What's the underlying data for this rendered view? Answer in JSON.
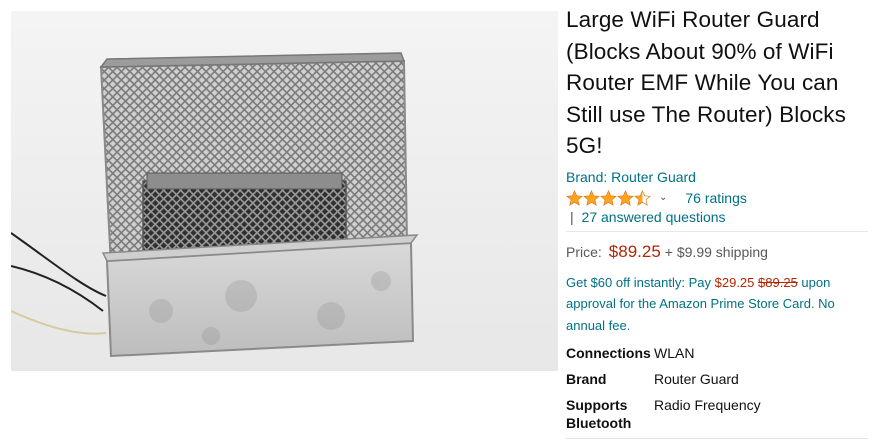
{
  "product": {
    "image_name": "router-guard-product-photo",
    "title": "Large WiFi Router Guard (Blocks About 90% of WiFi Router EMF While You can Still use The Router) Blocks 5G!",
    "brand_link": "Brand: Router Guard",
    "rating": {
      "stars": 4.5,
      "ratings_count": "76 ratings",
      "answered_questions": "27 answered questions",
      "separator": "|"
    },
    "price": {
      "label": "Price:",
      "amount": "$89.25",
      "shipping": "+ $9.99 shipping"
    },
    "promo": {
      "lead": "Get $60 off instantly: Pay ",
      "new_price": "$29.25",
      "old_price": "$89.25",
      "tail": " upon approval for the Amazon Prime Store Card. No annual fee."
    },
    "specs": [
      {
        "key": "Connections",
        "value": "WLAN"
      },
      {
        "key": "Brand",
        "value": "Router Guard"
      },
      {
        "key": "Supports Bluetooth",
        "value": "Radio Frequency"
      }
    ]
  },
  "colors": {
    "link": "#007185",
    "price": "#b12704",
    "star": "#ffa41c"
  },
  "icons": {
    "star": "star-icon",
    "chevron": "chevron-down-icon"
  }
}
